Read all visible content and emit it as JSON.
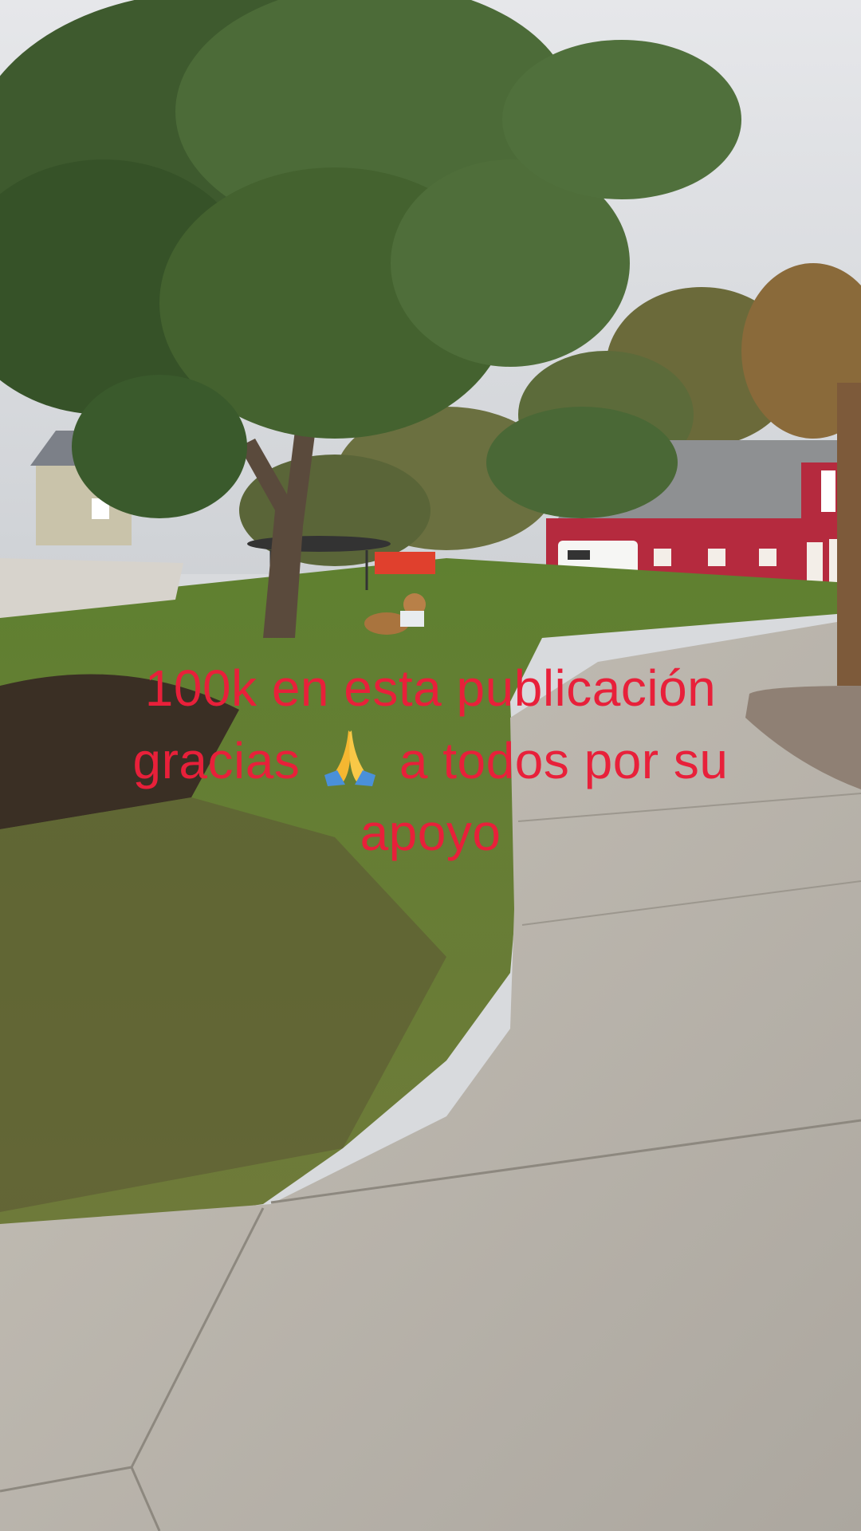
{
  "caption": {
    "line1": "100k en esta publicación",
    "line2_before": "gracias",
    "line2_after": "a todos por su",
    "line3": "apoyo",
    "emoji_icon": "folded-hands-icon",
    "color": "#e8203a"
  },
  "colors": {
    "sky": "#dcdee2",
    "grass": "#6f8a3a",
    "sidewalk": "#b9b4ab",
    "barn": "#b52a3e",
    "roof": "#8a8c8f"
  }
}
